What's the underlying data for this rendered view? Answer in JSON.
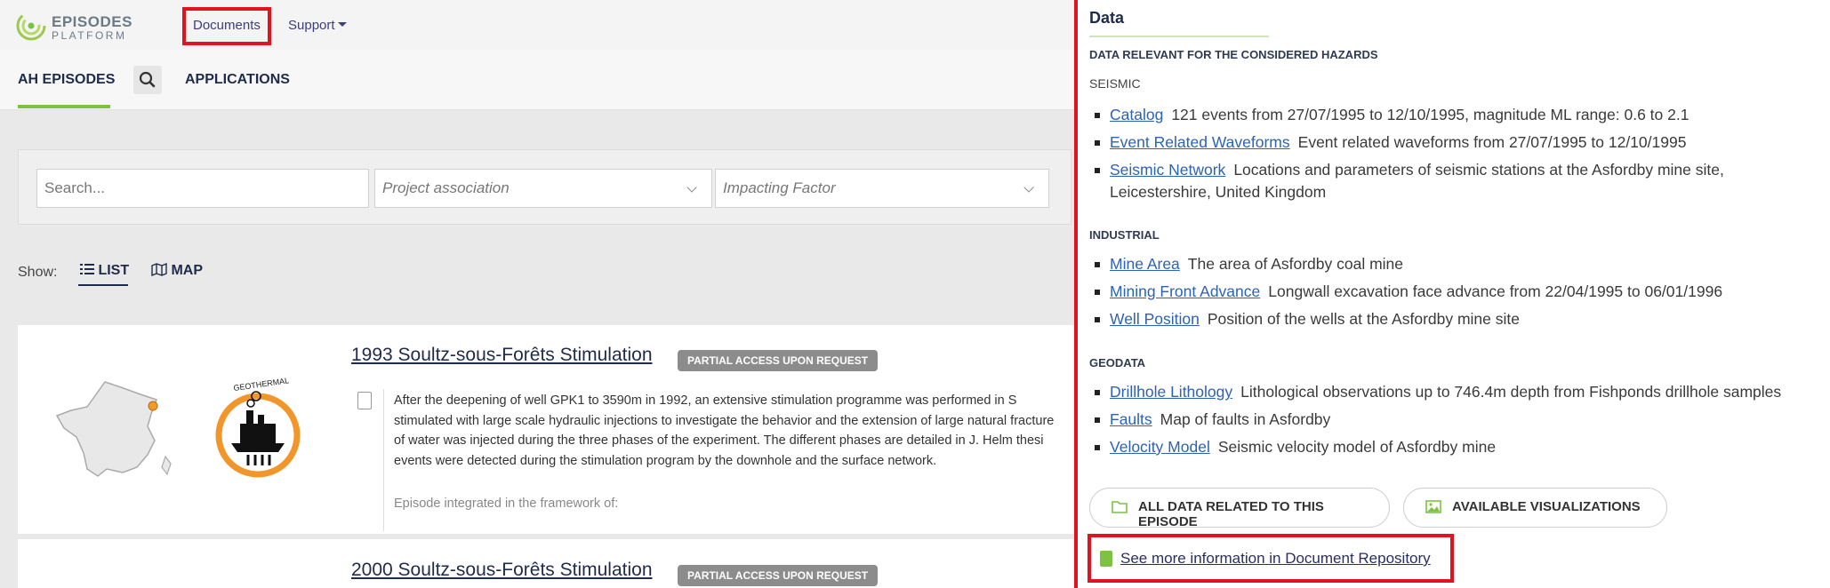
{
  "logo": {
    "line1": "EPISODES",
    "line2": "PLATFORM"
  },
  "nav": {
    "documents": "Documents",
    "support": "Support"
  },
  "tabs": {
    "episodes": "AH EPISODES",
    "applications": "APPLICATIONS"
  },
  "filters": {
    "search_placeholder": "Search...",
    "project": "Project association",
    "impacting": "Impacting Factor"
  },
  "show": {
    "label": "Show:",
    "list": "LIST",
    "map": "MAP"
  },
  "cards": [
    {
      "title": "1993 Soultz-sous-Forêts Stimulation",
      "badge": "PARTIAL ACCESS UPON REQUEST",
      "lines": [
        "After the deepening of well GPK1 to 3590m in 1992, an extensive stimulation programme was performed in S",
        "stimulated with large scale hydraulic injections to investigate the behavior and the extension of large natural fracture",
        "of water was injected during the three phases of the experiment. The different phases are detailed in J. Helm thesi",
        "events were detected during the stimulation program by the downhole and the surface network."
      ],
      "framework": "Episode integrated in the framework of:"
    },
    {
      "title": "2000 Soultz-sous-Forêts Stimulation",
      "badge": "PARTIAL ACCESS UPON REQUEST"
    }
  ],
  "panel": {
    "title": "Data",
    "relevant": "DATA RELEVANT FOR THE CONSIDERED HAZARDS",
    "seismic": {
      "label": "SEISMIC",
      "items": [
        {
          "link": "Catalog",
          "desc": "121 events from 27/07/1995 to 12/10/1995, magnitude ML range: 0.6 to 2.1"
        },
        {
          "link": "Event Related Waveforms",
          "desc": "Event related waveforms from 27/07/1995 to 12/10/1995"
        },
        {
          "link": "Seismic Network",
          "desc": "Locations and parameters of seismic stations at the Asfordby mine site, Leicestershire, United Kingdom"
        }
      ]
    },
    "industrial": {
      "label": "INDUSTRIAL",
      "items": [
        {
          "link": "Mine Area",
          "desc": "The area of Asfordby coal mine"
        },
        {
          "link": "Mining Front Advance",
          "desc": "Longwall excavation face advance from 22/04/1995 to 06/01/1996"
        },
        {
          "link": "Well Position",
          "desc": "Position of the wells at the Asfordby mine site"
        }
      ]
    },
    "geodata": {
      "label": "GEODATA",
      "items": [
        {
          "link": "Drillhole Lithology",
          "desc": "Lithological observations up to 746.4m depth from Fishponds drillhole samples"
        },
        {
          "link": "Faults",
          "desc": "Map of faults in Asfordby"
        },
        {
          "link": "Velocity Model",
          "desc": "Seismic velocity model of Asfordby mine"
        }
      ]
    },
    "buttons": {
      "all_data": "ALL DATA RELATED TO THIS EPISODE",
      "visualizations": "AVAILABLE VISUALIZATIONS"
    },
    "doc_link": "See more information in Document Repository"
  },
  "colors": {
    "accent_green": "#7cc243",
    "highlight_red": "#e0141e",
    "link_blue": "#2f61b5",
    "navy": "#1f2b4a"
  }
}
